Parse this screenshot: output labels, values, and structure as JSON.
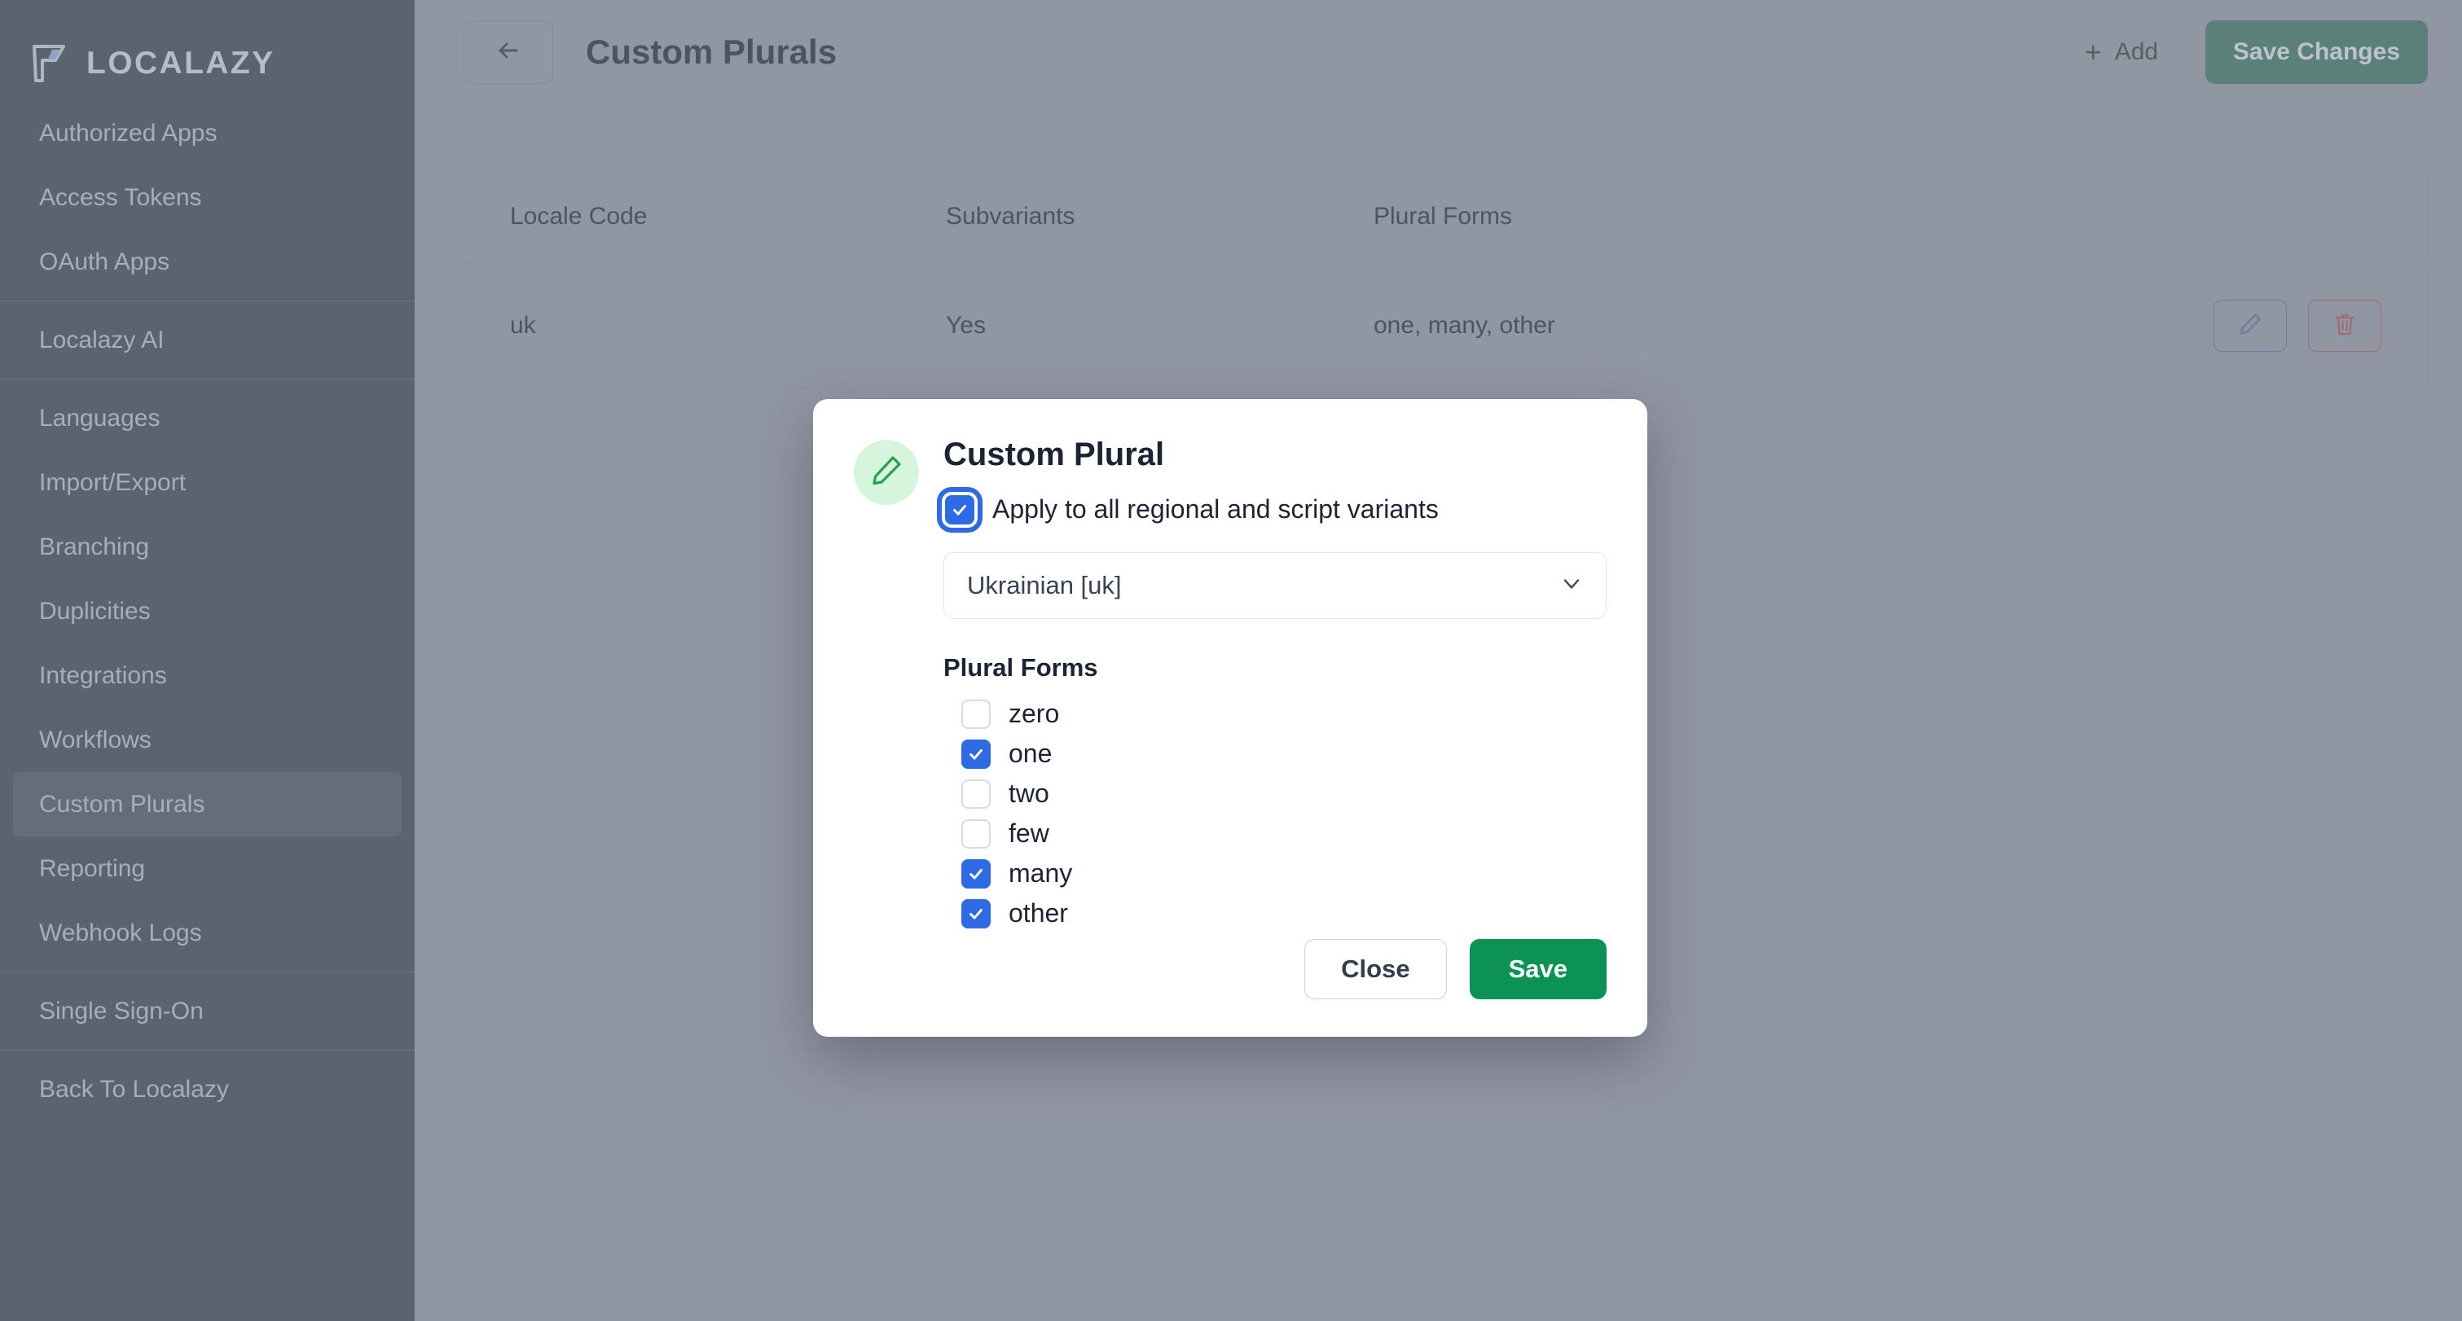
{
  "brand": {
    "name": "LOCALAZY",
    "logo_icon": "localazy-flag-logo"
  },
  "sidebar": {
    "groups": [
      {
        "items": [
          {
            "label": "Authorized Apps",
            "active": false
          },
          {
            "label": "Access Tokens",
            "active": false
          },
          {
            "label": "OAuth Apps",
            "active": false
          }
        ]
      },
      {
        "items": [
          {
            "label": "Localazy AI",
            "active": false
          }
        ]
      },
      {
        "items": [
          {
            "label": "Languages",
            "active": false
          },
          {
            "label": "Import/Export",
            "active": false
          },
          {
            "label": "Branching",
            "active": false
          },
          {
            "label": "Duplicities",
            "active": false
          },
          {
            "label": "Integrations",
            "active": false
          },
          {
            "label": "Workflows",
            "active": false
          },
          {
            "label": "Custom Plurals",
            "active": true
          },
          {
            "label": "Reporting",
            "active": false
          },
          {
            "label": "Webhook Logs",
            "active": false
          }
        ]
      },
      {
        "items": [
          {
            "label": "Single Sign-On",
            "active": false
          }
        ]
      },
      {
        "items": [
          {
            "label": "Back To Localazy",
            "active": false
          }
        ]
      }
    ]
  },
  "topbar": {
    "back_icon": "arrow-left-icon",
    "title": "Custom Plurals",
    "add_label": "Add",
    "add_icon": "plus-icon",
    "save_changes_label": "Save Changes"
  },
  "table": {
    "columns": [
      "Locale Code",
      "Subvariants",
      "Plural Forms"
    ],
    "rows": [
      {
        "locale_code": "uk",
        "subvariants": "Yes",
        "plural_forms": "one, many, other",
        "edit_icon": "pencil-icon",
        "delete_icon": "trash-icon"
      }
    ]
  },
  "modal": {
    "badge_icon": "pencil-icon",
    "title": "Custom Plural",
    "apply_all": {
      "label": "Apply to all regional and script variants",
      "checked": true,
      "focused": true
    },
    "locale_select": {
      "value": "Ukrainian  [uk]",
      "chevron_icon": "chevron-down-icon"
    },
    "plural_forms_label": "Plural Forms",
    "plural_forms": [
      {
        "label": "zero",
        "checked": false
      },
      {
        "label": "one",
        "checked": true
      },
      {
        "label": "two",
        "checked": false
      },
      {
        "label": "few",
        "checked": false
      },
      {
        "label": "many",
        "checked": true
      },
      {
        "label": "other",
        "checked": true
      }
    ],
    "close_label": "Close",
    "save_label": "Save"
  },
  "colors": {
    "sidebar_bg": "#5a6470",
    "content_dimmed_bg": "#9196a3",
    "checkbox_blue": "#2d6ae3",
    "save_green": "#0b9254",
    "badge_green_bg": "#d6f5dd",
    "badge_green_fg": "#27a34b",
    "edit_blue": "#6b7f9e",
    "delete_red": "#9e6d78"
  }
}
